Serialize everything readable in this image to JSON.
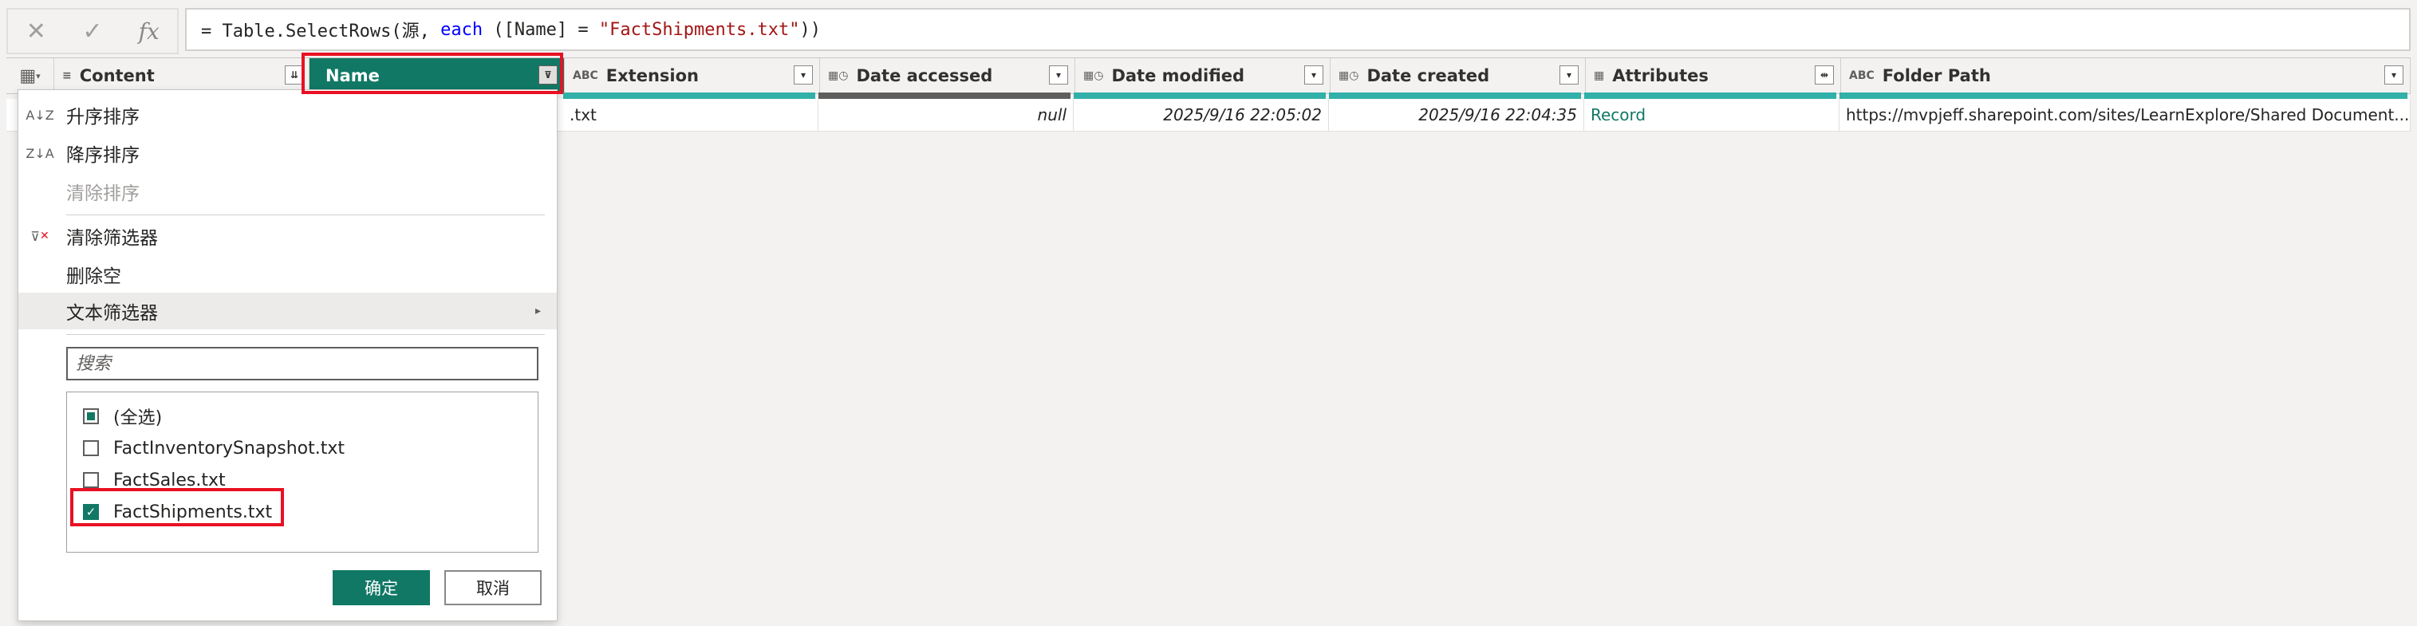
{
  "formula_bar": {
    "cancel_icon": "✕",
    "commit_icon": "✓",
    "fx_label": "fx",
    "formula": {
      "prefix": "= Table.SelectRows(源, ",
      "keyword": "each",
      "middle": " ([Name] = ",
      "string": "\"FactShipments.txt\"",
      "suffix": "))"
    }
  },
  "columns": [
    {
      "key": "content",
      "label": "Content",
      "type_icon": "≡",
      "dropdown_icon": "⇊"
    },
    {
      "key": "name",
      "label": "Name",
      "type_icon": "",
      "dropdown_icon": "⊽"
    },
    {
      "key": "extension",
      "label": "Extension",
      "type_icon": "ABC",
      "dropdown_icon": "▾"
    },
    {
      "key": "date_accessed",
      "label": "Date accessed",
      "type_icon": "▦◷",
      "dropdown_icon": "▾"
    },
    {
      "key": "date_modified",
      "label": "Date modified",
      "type_icon": "▦◷",
      "dropdown_icon": "▾"
    },
    {
      "key": "date_created",
      "label": "Date created",
      "type_icon": "▦◷",
      "dropdown_icon": "▾"
    },
    {
      "key": "attributes",
      "label": "Attributes",
      "type_icon": "▦",
      "dropdown_icon": "⇹"
    },
    {
      "key": "folder_path",
      "label": "Folder Path",
      "type_icon": "ABC",
      "dropdown_icon": "▾"
    }
  ],
  "row": {
    "extension": ".txt",
    "date_accessed": "null",
    "date_modified": "2025/9/16 22:05:02",
    "date_created": "2025/9/16 22:04:35",
    "attributes": "Record",
    "folder_path": "https://mvpjeff.sharepoint.com/sites/LearnExplore/Shared Document..."
  },
  "menu": {
    "sort_asc": "升序排序",
    "sort_desc": "降序排序",
    "clear_sort": "清除排序",
    "clear_filter": "清除筛选器",
    "remove_empty": "删除空",
    "text_filters": "文本筛选器",
    "search_placeholder": "搜索",
    "options": [
      {
        "label": "(全选)",
        "state": "partial"
      },
      {
        "label": "FactInventorySnapshot.txt",
        "state": "unchecked"
      },
      {
        "label": "FactSales.txt",
        "state": "unchecked"
      },
      {
        "label": "FactShipments.txt",
        "state": "checked"
      }
    ],
    "ok_label": "确定",
    "cancel_label": "取消"
  },
  "colors": {
    "accent": "#117865",
    "quality_bar": "#30b0a8",
    "highlight": "#e81123"
  }
}
